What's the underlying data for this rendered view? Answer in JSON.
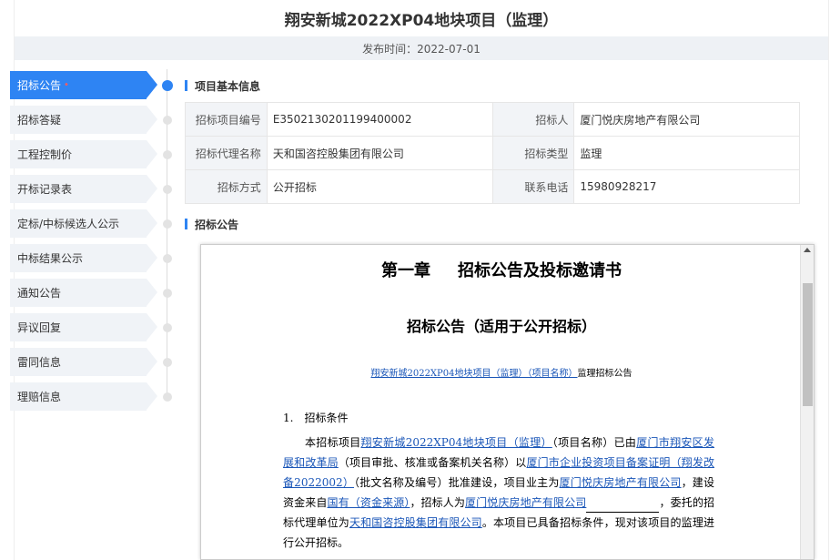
{
  "page": {
    "title": "翔安新城2022XP04地块项目（监理）",
    "publish_date": "发布时间：2022-07-01"
  },
  "sidebar": {
    "items": [
      {
        "label": "招标公告",
        "active": true,
        "required_mark": "•"
      },
      {
        "label": "招标答疑"
      },
      {
        "label": "工程控制价"
      },
      {
        "label": "开标记录表"
      },
      {
        "label": "定标/中标候选人公示"
      },
      {
        "label": "中标结果公示"
      },
      {
        "label": "通知公告"
      },
      {
        "label": "异议回复"
      },
      {
        "label": "雷同信息"
      },
      {
        "label": "理赔信息"
      }
    ]
  },
  "basic_info": {
    "heading": "项目基本信息",
    "rows": [
      {
        "l1": "招标项目编号",
        "v1": "E3502130201199400002",
        "l2": "招标人",
        "v2": "厦门悦庆房地产有限公司"
      },
      {
        "l1": "招标代理名称",
        "v1": "天和国咨控股集团有限公司",
        "l2": "招标类型",
        "v2": "监理"
      },
      {
        "l1": "招标方式",
        "v1": "公开招标",
        "l2": "联系电话",
        "v2": "15980928217"
      }
    ]
  },
  "notice": {
    "heading": "招标公告",
    "chapter_left": "第一章",
    "chapter_right": "招标公告及投标邀请书",
    "subtitle": "招标公告（适用于公开招标）",
    "project_link": "翔安新城2022XP04地块项目（监理）（项目名称）",
    "project_suffix": "监理招标公告",
    "section1": "1.　招标条件",
    "p1_a": "本招标项目",
    "p1_proj": "翔安新城2022XP04地块项目（监理）",
    "p1_b": "（项目名称）已由",
    "p1_approver": "厦门市翔安区发展和改革局",
    "p1_c": "（项目审批、核准或备案机关名称）以",
    "p1_doc": "厦门市企业投资项目备案证明（翔发改备2022002）",
    "p1_d": "（批文名称及编号）批准建设，项目业主为",
    "p1_owner": "厦门悦庆房地产有限公司",
    "p1_e": "，建设资金来自",
    "p1_fund": "国有（资金来源）",
    "p1_f": "，招标人为",
    "p1_tenderer": "厦门悦庆房地产有限公司",
    "p1_g": "，委托的招标代理单位为",
    "p1_agent": "天和国咨控股集团有限公司",
    "p1_h": "。本项目已具备招标条件，现对该项目的监理进行公开招标。"
  }
}
